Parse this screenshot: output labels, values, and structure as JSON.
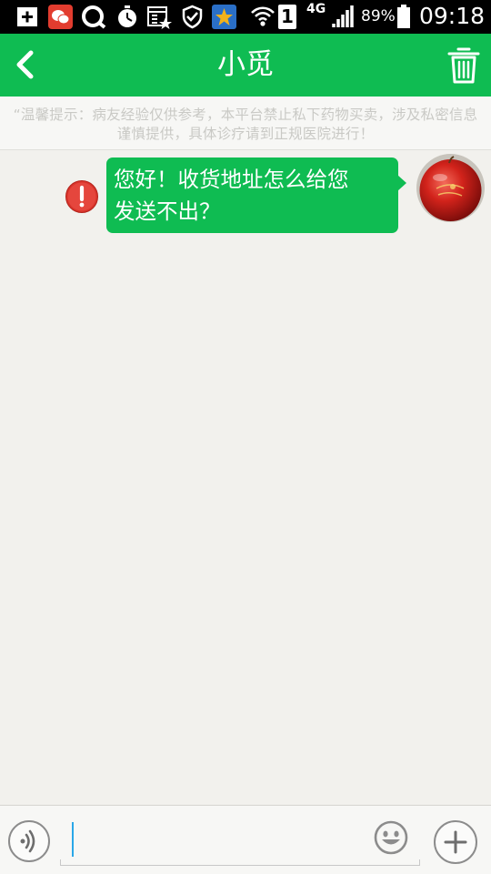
{
  "status_bar": {
    "sim_label": "1",
    "network_label": "4G",
    "battery_percent": "89%",
    "time": "09:18",
    "icons": [
      "add-icon",
      "wechat-icon",
      "browser-icon",
      "stopwatch-icon",
      "calendar-star-icon",
      "shield-check-icon",
      "star-app-icon",
      "wifi-icon",
      "signal-icon",
      "battery-icon"
    ]
  },
  "header": {
    "title": "小觅",
    "back_icon": "chevron-left-icon",
    "delete_icon": "trash-icon"
  },
  "notice": {
    "text": "“温馨提示：病友经验仅供参考，本平台禁止私下药物买卖，涉及私密信息谨慎提供，具体诊疗请到正规医院进行！"
  },
  "messages": [
    {
      "direction": "outgoing",
      "lines": [
        "您好！收货地址怎么给您",
        "发送不出？"
      ],
      "status": "failed"
    }
  ],
  "input": {
    "value": "",
    "placeholder": ""
  },
  "colors": {
    "brand_green": "#0fbc52",
    "error_red": "#d9342b",
    "background": "#f2f1ed"
  }
}
